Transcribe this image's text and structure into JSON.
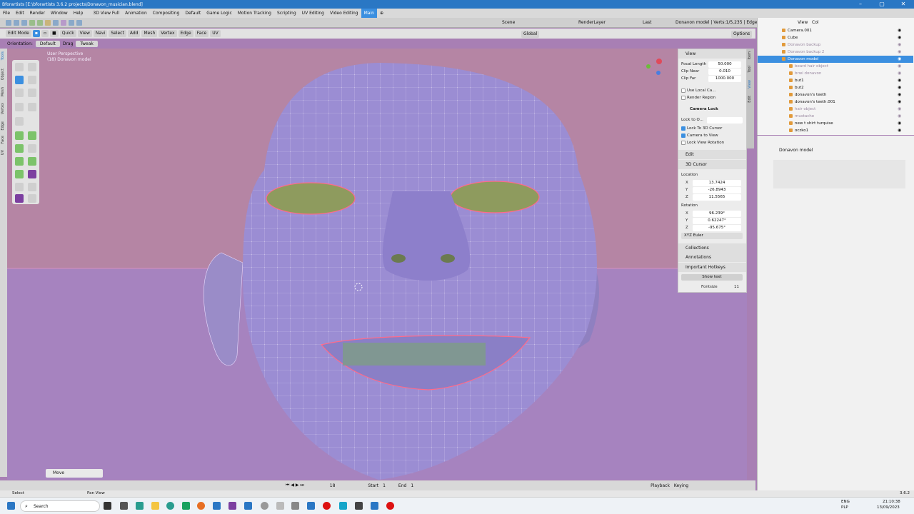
{
  "window": {
    "title": "Bforartists [E:\\bforartists 3.6.2 projects\\Donavon_musician.blend]",
    "controls": [
      "–",
      "▢",
      "✕"
    ]
  },
  "menubar": {
    "items": [
      "File",
      "Edit",
      "Render",
      "Window",
      "Help"
    ],
    "workspaces": [
      "3D View Full",
      "Animation",
      "Compositing",
      "Default",
      "Game Logic",
      "Motion Tracking",
      "Scripting",
      "UV Editing",
      "Video Editing",
      "Main"
    ],
    "active_workspace": "Main"
  },
  "topheader": {
    "scene": "Scene",
    "renderlayer": "RenderLayer",
    "last": "Last",
    "stats": "Donavon model | Verts:1/5,235 | Edges:0/"
  },
  "editheader": {
    "mode": "Edit Mode",
    "menus": [
      "Quick",
      "View",
      "Navi",
      "Select",
      "Add",
      "Mesh",
      "Vertex",
      "Edge",
      "Face",
      "UV"
    ],
    "transform": "Global",
    "options": "Options"
  },
  "toolheader": {
    "orientation_label": "Orientation:",
    "orientation": "Default",
    "drag_label": "Drag",
    "drag": "Tweak"
  },
  "sidetabs": [
    "Tools",
    "Object",
    "Mesh",
    "Vertex",
    "Edge",
    "Face",
    "UV"
  ],
  "viewport": {
    "persp": "User Perspective",
    "object": "(18) Donavon model",
    "op_panel": "Move"
  },
  "npanel": {
    "view_header": "View",
    "focal_label": "Focal Length",
    "focal": "50.000",
    "clipnear_label": "Clip Near",
    "clipnear": "0.010",
    "clipfar_label": "Clip Far",
    "clipfar": "1000.000",
    "use_local": "Use Local Ca...",
    "render_region": "Render Region",
    "camera_lock": "Camera Lock",
    "lock_to": "Lock to O...",
    "lock_cursor": "Lock To 3D Cursor",
    "camera_to_view": "Camera to View",
    "lock_rotation": "Lock View Rotation",
    "edit": "Edit",
    "cursor_header": "3D Cursor",
    "location": "Location",
    "lx": "13.7424",
    "ly": "-26.8943",
    "lz": "11.5565",
    "rotation": "Rotation",
    "rx": "96.239°",
    "ry": "0.62247°",
    "rz": "-95.675°",
    "euler": "XYZ Euler",
    "collections": "Collections",
    "annotations": "Annotations",
    "hotkeys": "Important Hotkeys",
    "show_text": "Show text",
    "fontsize_label": "Fontsize",
    "fontsize": "11"
  },
  "rtabs": [
    "Item",
    "Tool",
    "View",
    "Edit"
  ],
  "outliner": {
    "header": [
      "View",
      "Col"
    ],
    "rows": [
      {
        "name": "Camera.001",
        "state": "normal"
      },
      {
        "name": "Cube",
        "state": "normal"
      },
      {
        "name": "Donavon backup",
        "state": "dim"
      },
      {
        "name": "Donavon backup 2",
        "state": "dim"
      },
      {
        "name": "Donavon model",
        "state": "selected"
      },
      {
        "name": "beard hair object",
        "state": "dim"
      },
      {
        "name": "brwi donavon",
        "state": "dim"
      },
      {
        "name": "but1",
        "state": "normal"
      },
      {
        "name": "but2",
        "state": "normal"
      },
      {
        "name": "donavon's teeth",
        "state": "normal"
      },
      {
        "name": "donavon's teeth.001",
        "state": "normal"
      },
      {
        "name": "hair object",
        "state": "dim"
      },
      {
        "name": "mustache",
        "state": "dim"
      },
      {
        "name": "new t shirt turquise",
        "state": "normal"
      },
      {
        "name": "oczko1",
        "state": "normal"
      }
    ]
  },
  "props": {
    "object": "Donavon model"
  },
  "timeline": {
    "frame": "18",
    "start_label": "Start",
    "start": "1",
    "end_label": "End",
    "end": "1",
    "playback": "Playback",
    "keying": "Keying"
  },
  "statusbar": {
    "left": "Select",
    "mid": "Pan View",
    "version": "3.6.2"
  },
  "taskbar": {
    "search": "Search",
    "lang": "ENG",
    "layout": "PLP",
    "time": "21:10:38",
    "date": "13/09/2023"
  }
}
